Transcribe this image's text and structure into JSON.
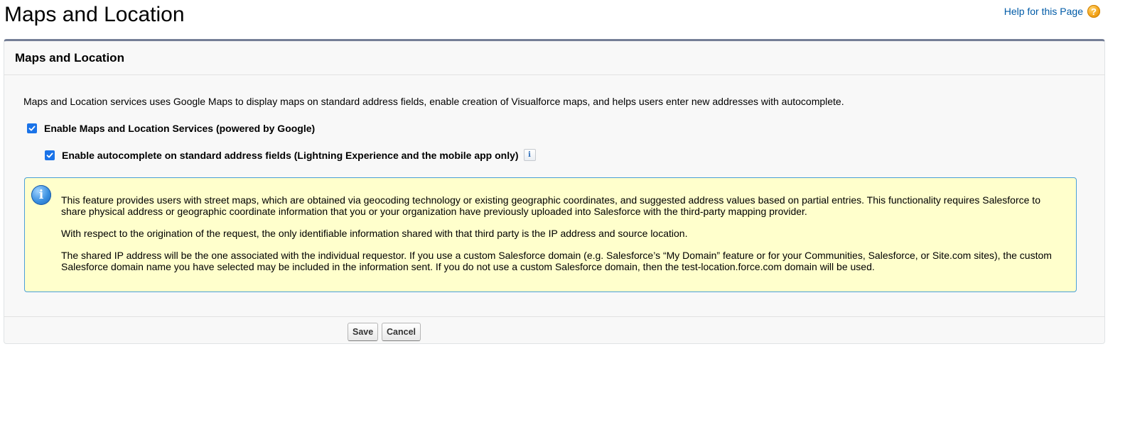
{
  "page": {
    "title": "Maps and Location",
    "help_link": "Help for this Page"
  },
  "icons": {
    "help": "help-icon",
    "info": "info-icon",
    "checkmark": "checkmark-icon"
  },
  "colors": {
    "link": "#015ba7",
    "checkbox": "#1a73e8",
    "notice_background": "#ffffcc",
    "notice_border": "#4a9fd8",
    "panel_top_border": "#747e96"
  },
  "panel": {
    "title": "Maps and Location",
    "description": "Maps and Location services uses Google Maps to display maps on standard address fields, enable creation of Visualforce maps, and helps users enter new addresses with autocomplete.",
    "options": [
      {
        "label": "Enable Maps and Location Services (powered by Google)",
        "checked": true
      },
      {
        "label": "Enable autocomplete on standard address fields (Lightning Experience and the mobile app only)",
        "checked": true
      }
    ],
    "notice": {
      "paragraphs": [
        "This feature provides users with street maps, which are obtained via geocoding technology or existing geographic coordinates, and suggested address values based on partial entries. This functionality requires Salesforce to share physical address or geographic coordinate information that you or your organization have previously uploaded into Salesforce with the third-party mapping provider.",
        "With respect to the origination of the request, the only identifiable information shared with that third party is the IP address and source location.",
        "The shared IP address will be the one associated with the individual requestor. If you use a custom Salesforce domain (e.g. Salesforce’s “My Domain” feature or for your Communities, Salesforce, or Site.com sites), the custom Salesforce domain name you have selected may be included in the information sent. If you do not use a custom Salesforce domain, then the test-location.force.com domain will be used."
      ]
    }
  },
  "buttons": {
    "save": "Save",
    "cancel": "Cancel"
  }
}
